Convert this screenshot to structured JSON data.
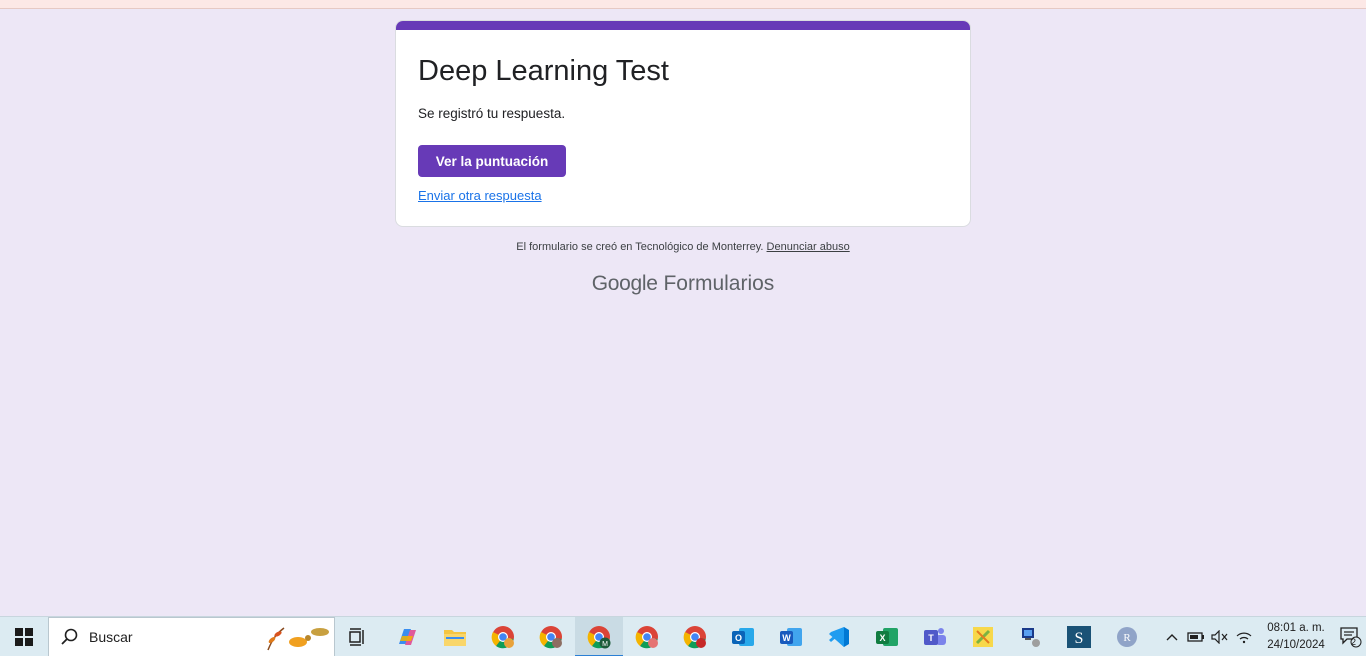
{
  "form": {
    "title": "Deep Learning Test",
    "confirmation": "Se registró tu respuesta.",
    "score_button": "Ver la puntuación",
    "another_link": "Enviar otra respuesta"
  },
  "footer": {
    "note": "El formulario se creó en Tecnológico de Monterrey.",
    "abuse_link": "Denunciar abuso",
    "brand_google": "Google",
    "brand_forms": "Formularios"
  },
  "taskbar": {
    "search_placeholder": "Buscar",
    "apps": [
      "task-view",
      "copilot",
      "file-explorer",
      "chrome-a",
      "chrome-b",
      "chrome-m",
      "chrome-c",
      "chrome-d",
      "outlook",
      "word",
      "vscode",
      "excel",
      "teams",
      "app-yellow",
      "app-network",
      "app-s",
      "app-r"
    ],
    "time": "08:01 a. m.",
    "date": "24/10/2024",
    "notifications_count": "2"
  },
  "colors": {
    "accent": "#673ab7",
    "page_bg": "#ede7f6",
    "link": "#1a73e8"
  }
}
